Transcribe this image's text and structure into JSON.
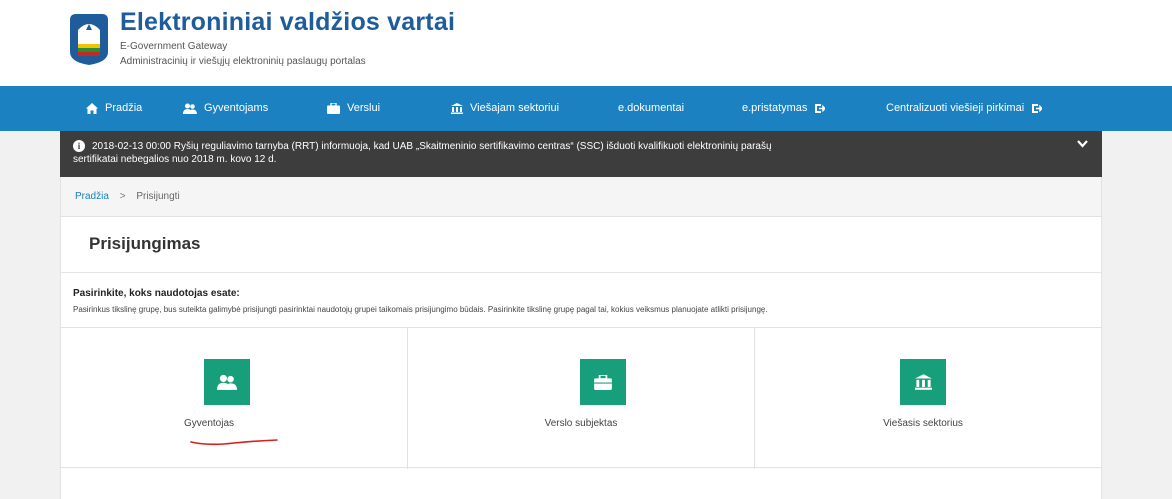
{
  "header": {
    "title": "Elektroniniai valdžios vartai",
    "subtitle_en": "E-Government Gateway",
    "subtitle_lt": "Administracinių ir viešųjų elektroninių paslaugų portalas"
  },
  "nav": {
    "items": [
      {
        "label": "Pradžia",
        "icon": "home-icon"
      },
      {
        "label": "Gyventojams",
        "icon": "users-icon"
      },
      {
        "label": "Verslui",
        "icon": "briefcase-icon"
      },
      {
        "label": "Viešajam sektoriui",
        "icon": "institution-icon"
      },
      {
        "label": "e.dokumentai",
        "icon": ""
      },
      {
        "label": "e.pristatymas",
        "icon": "external-link-icon"
      },
      {
        "label": "Centralizuoti viešieji pirkimai",
        "icon": "external-link-icon"
      }
    ]
  },
  "notice": {
    "line1": "2018-02-13 00:00   Ryšių reguliavimo tarnyba (RRT) informuoja, kad UAB „Skaitmeninio sertifikavimo centras“ (SSC) išduoti kvalifikuoti elektroninių parašų",
    "line2": "sertifikatai nebegalios nuo 2018 m. kovo 12 d."
  },
  "breadcrumb": {
    "home": "Pradžia",
    "separator": ">",
    "current": "Prisijungti"
  },
  "page": {
    "title": "Prisijungimas",
    "choose_heading": "Pasirinkite, koks naudotojas esate:",
    "choose_text": "Pasirinkus tikslinę grupę, bus suteikta galimybė prisijungti pasirinktai naudotojų grupei taikomais prisijungimo būdais. Pasirinkite tikslinę grupę pagal tai, kokius veiksmus planuojate atlikti prisijungę."
  },
  "options": [
    {
      "label": "Gyventojas",
      "icon": "users-icon"
    },
    {
      "label": "Verslo subjektas",
      "icon": "briefcase-icon"
    },
    {
      "label": "Viešasis sektorius",
      "icon": "institution-icon"
    }
  ],
  "colors": {
    "brand_blue": "#1b81c1",
    "title_blue": "#1f5c9c",
    "tile_green": "#179e7a",
    "notice_bg": "#3d3d3d",
    "annotation_red": "#d62020"
  }
}
